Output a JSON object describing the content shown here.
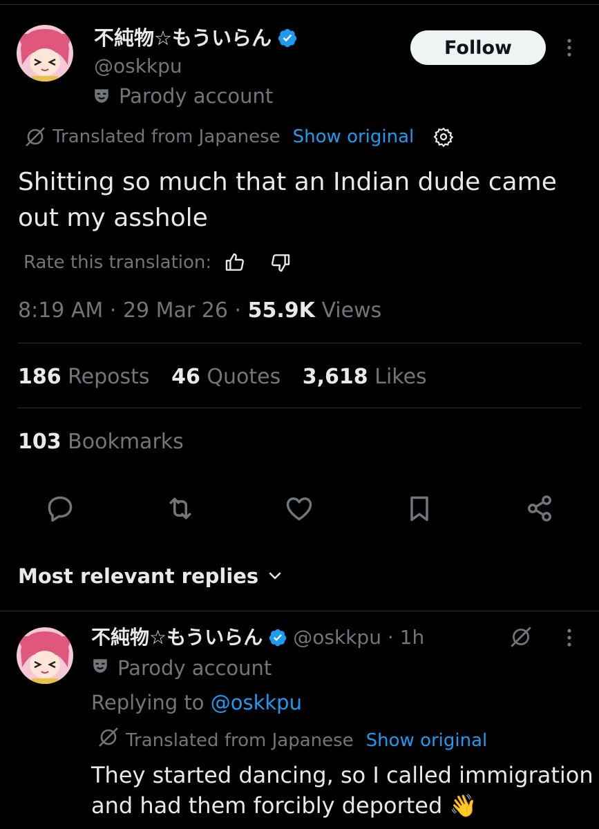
{
  "tweet": {
    "display_name": "不純物☆もういらん",
    "handle": "@oskkpu",
    "parody_label": "Parody account",
    "follow_label": "Follow",
    "translated_label": "Translated from Japanese",
    "show_original": "Show original",
    "text_line1": "Shitting so much that an Indian dude came",
    "text_line2": "out my asshole",
    "rate_translation": "Rate this translation:",
    "time": "8:19 AM",
    "sep1": "·",
    "date": "29 Mar 26",
    "sep2": "·",
    "views_count": "55.9K",
    "views_label": "Views",
    "reposts_count": "186",
    "reposts_label": "Reposts",
    "quotes_count": "46",
    "quotes_label": "Quotes",
    "likes_count": "3,618",
    "likes_label": "Likes",
    "bookmarks_count": "103",
    "bookmarks_label": "Bookmarks"
  },
  "replies_sort": "Most relevant replies",
  "reply": {
    "display_name": "不純物☆もういらん",
    "handle_time": "@oskkpu · 1h",
    "parody_label": "Parody account",
    "replying_to_prefix": "Replying to",
    "replying_to_handle": "@oskkpu",
    "translated_label": "Translated from Japanese",
    "show_original": "Show original",
    "text_line1": "They started dancing, so I called immigration",
    "text_line2": "and had them forcibly deported",
    "emoji": "👋"
  },
  "colors": {
    "background": "#000000",
    "text": "#e7e9ea",
    "secondary": "#71767b",
    "link": "#1d9bf0",
    "verified": "#1d9bf0",
    "follow_bg": "#eff3f4"
  }
}
